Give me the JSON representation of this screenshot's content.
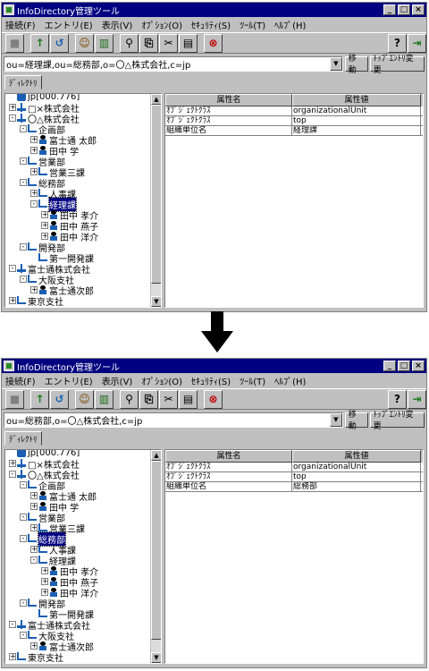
{
  "windows": [
    {
      "title": "InfoDirectory管理ツール",
      "menu": [
        "接続(F)",
        "エントリ(E)",
        "表示(V)",
        "ｵﾌﾟｼｮﾝ(O)",
        "ｾｷｭﾘﾃｨ(S)",
        "ﾂｰﾙ(T)",
        "ﾍﾙﾌﾟ(H)"
      ],
      "address": "ou=経理課,ou=総務部,o=〇△株式会社,c=jp",
      "move_button": "移動",
      "top_entry_button": "ﾄｯﾌﾟｴﾝﾄﾘ変更",
      "tab": "ﾃﾞｨﾚｸﾄﾘ",
      "tree": [
        {
          "label": "jp[000.776]",
          "level": 0,
          "icon": "root",
          "exp": ""
        },
        {
          "label": "□×株式会社",
          "level": 0,
          "icon": "org",
          "exp": "+"
        },
        {
          "label": "〇△株式会社",
          "level": 0,
          "icon": "org",
          "exp": "-"
        },
        {
          "label": "企画部",
          "level": 1,
          "icon": "ou",
          "exp": "-"
        },
        {
          "label": "富士通 太郎",
          "level": 2,
          "icon": "person",
          "exp": "+"
        },
        {
          "label": "田中 学",
          "level": 2,
          "icon": "person",
          "exp": "+"
        },
        {
          "label": "営業部",
          "level": 1,
          "icon": "ou",
          "exp": "-"
        },
        {
          "label": "営業三課",
          "level": 2,
          "icon": "ou",
          "exp": "+"
        },
        {
          "label": "総務部",
          "level": 1,
          "icon": "ou",
          "exp": "-"
        },
        {
          "label": "人事課",
          "level": 2,
          "icon": "ou",
          "exp": "+"
        },
        {
          "label": "経理課",
          "level": 2,
          "icon": "ou",
          "exp": "-",
          "selected": true
        },
        {
          "label": "田中 孝介",
          "level": 3,
          "icon": "person",
          "exp": "+"
        },
        {
          "label": "田中 燕子",
          "level": 3,
          "icon": "person",
          "exp": "+"
        },
        {
          "label": "田中 洋介",
          "level": 3,
          "icon": "person",
          "exp": "+"
        },
        {
          "label": "開発部",
          "level": 1,
          "icon": "ou",
          "exp": "-"
        },
        {
          "label": "第一開発課",
          "level": 2,
          "icon": "ou",
          "exp": ""
        },
        {
          "label": "富士通株式会社",
          "level": 0,
          "icon": "org",
          "exp": "-"
        },
        {
          "label": "大阪支社",
          "level": 1,
          "icon": "ou",
          "exp": "-"
        },
        {
          "label": "富士通次郎",
          "level": 2,
          "icon": "person",
          "exp": "+"
        },
        {
          "label": "東京支社",
          "level": 0,
          "icon": "ou",
          "exp": "+"
        }
      ],
      "headers": [
        "属性名",
        "属性値"
      ],
      "rows": [
        [
          "ｵﾌﾞｼﾞｪｸﾄｸﾗｽ",
          "organizationalUnit"
        ],
        [
          "ｵﾌﾞｼﾞｪｸﾄｸﾗｽ",
          "top"
        ],
        [
          "組織単位名",
          "経理課"
        ]
      ]
    },
    {
      "title": "InfoDirectory管理ツール",
      "menu": [
        "接続(F)",
        "エントリ(E)",
        "表示(V)",
        "ｵﾌﾟｼｮﾝ(O)",
        "ｾｷｭﾘﾃｨ(S)",
        "ﾂｰﾙ(T)",
        "ﾍﾙﾌﾟ(H)"
      ],
      "address": "ou=総務部,o=〇△株式会社,c=jp",
      "move_button": "移動",
      "top_entry_button": "ﾄｯﾌﾟｴﾝﾄﾘ変更",
      "tab": "ﾃﾞｨﾚｸﾄﾘ",
      "tree": [
        {
          "label": "jp[000.776]",
          "level": 0,
          "icon": "root",
          "exp": ""
        },
        {
          "label": "□×株式会社",
          "level": 0,
          "icon": "org",
          "exp": "+"
        },
        {
          "label": "〇△株式会社",
          "level": 0,
          "icon": "org",
          "exp": "-"
        },
        {
          "label": "企画部",
          "level": 1,
          "icon": "ou",
          "exp": "-"
        },
        {
          "label": "富士通 太郎",
          "level": 2,
          "icon": "person",
          "exp": "+"
        },
        {
          "label": "田中 学",
          "level": 2,
          "icon": "person",
          "exp": "+"
        },
        {
          "label": "営業部",
          "level": 1,
          "icon": "ou",
          "exp": "-"
        },
        {
          "label": "営業三課",
          "level": 2,
          "icon": "ou",
          "exp": "+"
        },
        {
          "label": "総務部",
          "level": 1,
          "icon": "ou",
          "exp": "-",
          "selected": true
        },
        {
          "label": "人事課",
          "level": 2,
          "icon": "ou",
          "exp": "+"
        },
        {
          "label": "経理課",
          "level": 2,
          "icon": "ou",
          "exp": "-"
        },
        {
          "label": "田中 孝介",
          "level": 3,
          "icon": "person",
          "exp": "+"
        },
        {
          "label": "田中 燕子",
          "level": 3,
          "icon": "person",
          "exp": "+"
        },
        {
          "label": "田中 洋介",
          "level": 3,
          "icon": "person",
          "exp": "+"
        },
        {
          "label": "開発部",
          "level": 1,
          "icon": "ou",
          "exp": "-"
        },
        {
          "label": "第一開発課",
          "level": 2,
          "icon": "ou",
          "exp": ""
        },
        {
          "label": "富士通株式会社",
          "level": 0,
          "icon": "org",
          "exp": "-"
        },
        {
          "label": "大阪支社",
          "level": 1,
          "icon": "ou",
          "exp": "-"
        },
        {
          "label": "富士通次郎",
          "level": 2,
          "icon": "person",
          "exp": "+"
        },
        {
          "label": "東京支社",
          "level": 0,
          "icon": "ou",
          "exp": "+"
        }
      ],
      "headers": [
        "属性名",
        "属性値"
      ],
      "rows": [
        [
          "ｵﾌﾞｼﾞｪｸﾄｸﾗｽ",
          "organizationalUnit"
        ],
        [
          "ｵﾌﾞｼﾞｪｸﾄｸﾗｽ",
          "top"
        ],
        [
          "組織単位名",
          "総務部"
        ]
      ]
    }
  ],
  "title_controls": [
    "_",
    "□",
    "×"
  ],
  "toolbar_icons": [
    "stop-icon",
    "up-icon",
    "refresh-icon",
    "find-user-icon",
    "delete-icon",
    "search-icon",
    "copy-icon",
    "cut-icon",
    "paste-icon",
    "cancel-icon",
    "help-icon",
    "exit-icon"
  ],
  "colors": {
    "titlebar": "#000080",
    "face": "#c0c0c0",
    "selection": "#000080"
  }
}
